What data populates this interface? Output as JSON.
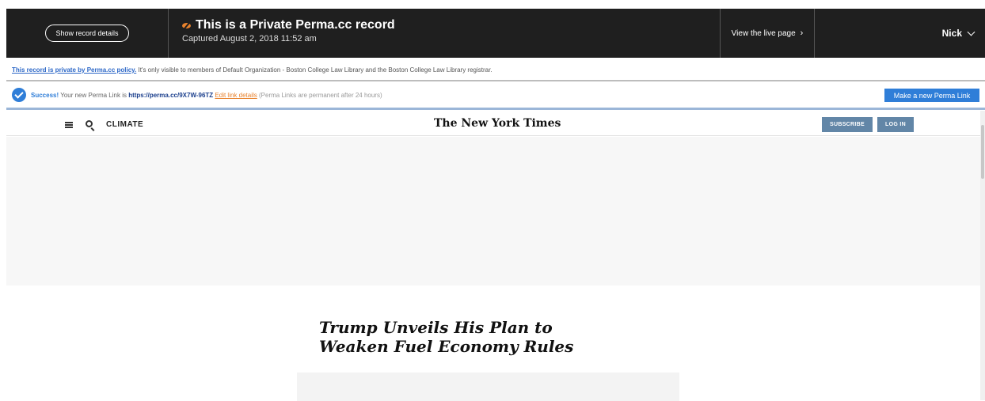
{
  "perma_bar": {
    "details_button": "Show record details",
    "title": "This is a Private Perma.cc record",
    "captured": "Captured August 2, 2018 11:52 am",
    "live_page": "View the live page",
    "live_chevron": "›",
    "user": "Nick"
  },
  "privacy": {
    "policy_link": "This record is private by Perma.cc policy.",
    "message": " It's only visible to members of Default Organization - Boston College Law Library and the Boston College Law Library registrar."
  },
  "success": {
    "label": "Success!",
    "text": " Your new Perma Link is ",
    "link": "https://perma.cc/9X7W-96TZ",
    "edit": "Edit link details",
    "note": "(Perma Links are permanent after 24 hours)",
    "new_button": "Make a new Perma Link"
  },
  "nyt": {
    "section": "CLIMATE",
    "logo": "The New York Times",
    "subscribe": "SUBSCRIBE",
    "login": "LOG IN",
    "headline_line1": "Trump Unveils His Plan to",
    "headline_line2": "Weaken Fuel Economy Rules"
  },
  "colors": {
    "perma_dark": "#1f1f1f",
    "accent_blue": "#2f7ed8",
    "accent_orange": "#e8822d",
    "nyt_button": "#6286a7"
  }
}
